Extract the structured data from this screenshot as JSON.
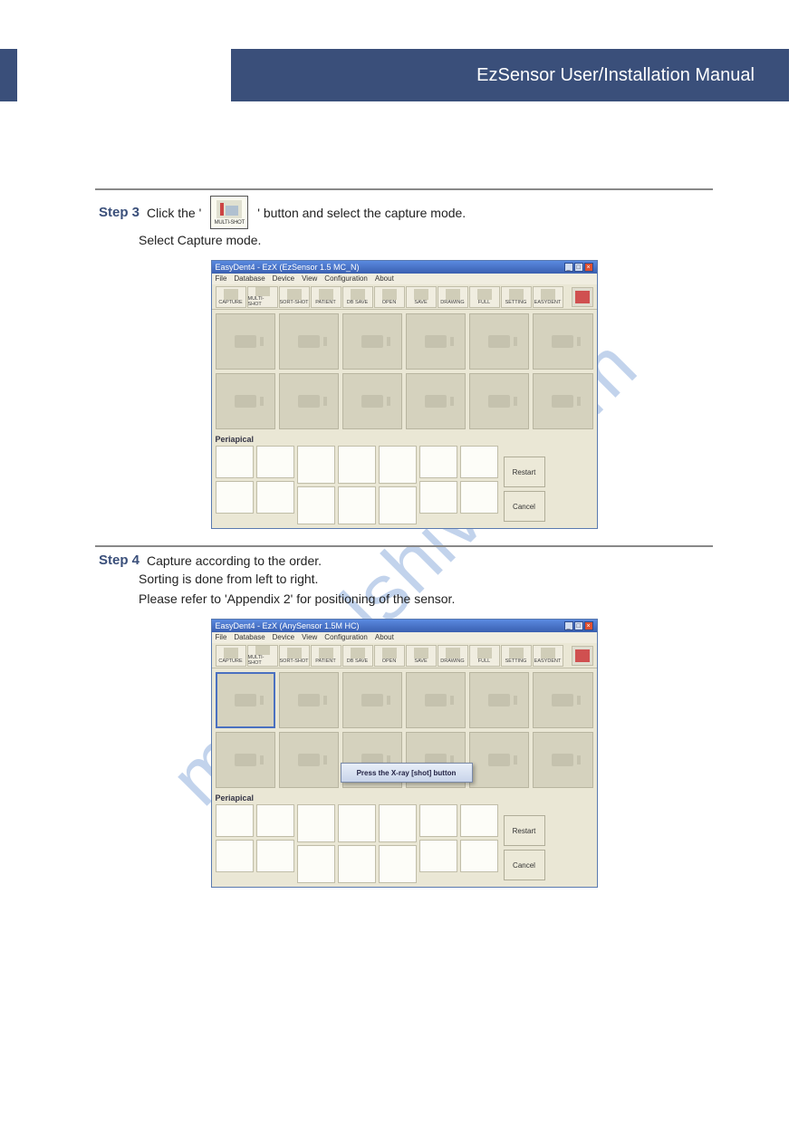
{
  "header": {
    "title": "EzSensor User/Installation Manual"
  },
  "section1": {
    "step_label": "Step 3",
    "step_text": "Click the 'MULTI-SHOT' button and select the capture mode.",
    "step_sub": "Select Capture mode.",
    "icon_label": "MULTI-SHOT"
  },
  "section2": {
    "step_label": "Step 4",
    "step_text": "Capture according to the order.",
    "step_sub1": "Sorting is done from left to right.",
    "step_sub2": "Please refer to 'Appendix 2' for positioning of the sensor.",
    "dialog_text": "Press the X-ray [shot] button"
  },
  "win": {
    "title1": "EasyDent4 - EzX (EzSensor 1.5 MC_N)",
    "title2": "EasyDent4 - EzX (AnySensor 1.5M HC)",
    "menu": [
      "File",
      "Database",
      "Device",
      "View",
      "Configuration",
      "About"
    ],
    "toolbar": [
      "CAPTURE",
      "MULTI-SHOT",
      "SORT-SHOT",
      "PATIENT",
      "DB SAVE",
      "OPEN",
      "SAVE",
      "DRAWING",
      "FULL",
      "SETTING",
      "EASYDENT"
    ],
    "peri_label": "Periapical",
    "restart": "Restart",
    "cancel": "Cancel"
  },
  "watermark": "manualshive.com"
}
